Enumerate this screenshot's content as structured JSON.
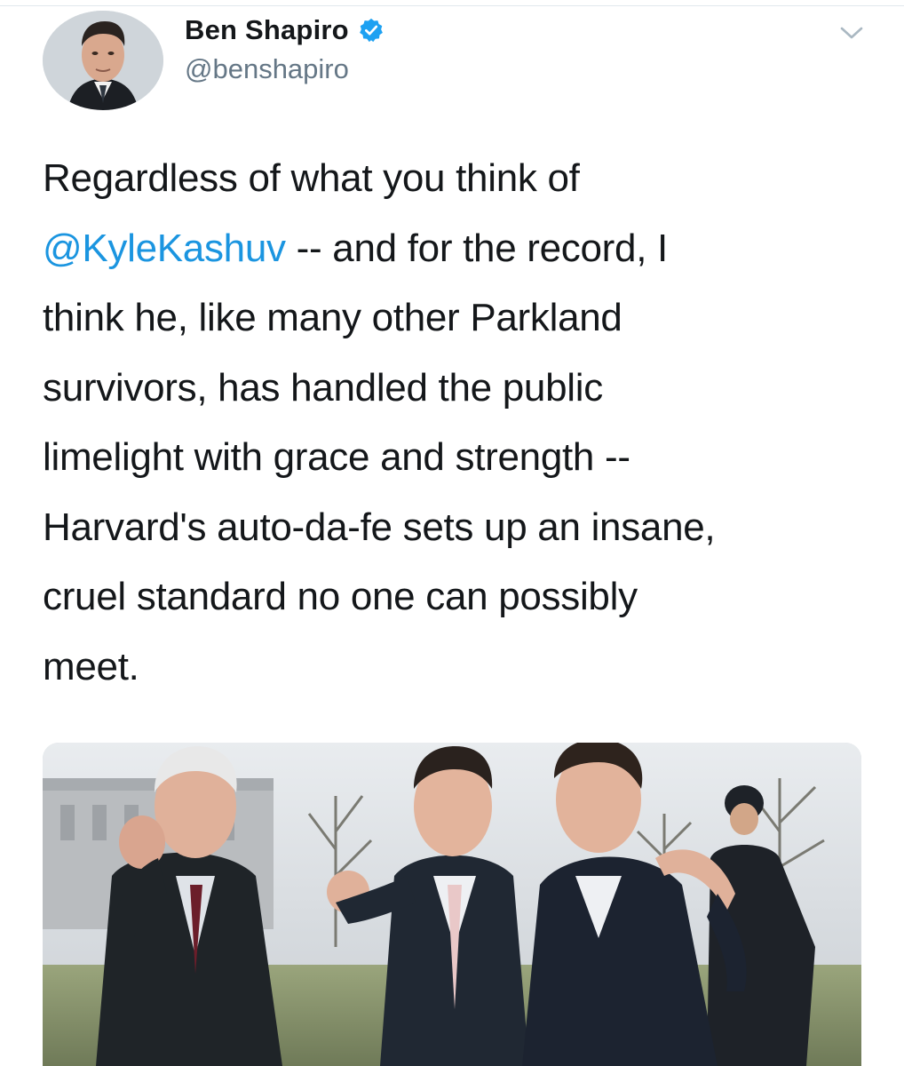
{
  "author": {
    "display_name": "Ben Shapiro",
    "handle": "@benshapiro",
    "verified": true,
    "verified_color": "#1da1f2"
  },
  "tweet": {
    "lines": [
      {
        "prefix": "Regardless of what you think of",
        "mention": "",
        "suffix": ""
      },
      {
        "prefix": "",
        "mention": "@KyleKashuv",
        "suffix": " -- and for the record, I"
      },
      {
        "prefix": "think he, like many other Parkland",
        "mention": "",
        "suffix": ""
      },
      {
        "prefix": "survivors, has handled the public",
        "mention": "",
        "suffix": ""
      },
      {
        "prefix": "limelight with grace and strength --",
        "mention": "",
        "suffix": ""
      },
      {
        "prefix": "Harvard's auto-da-fe sets up an insane,",
        "mention": "",
        "suffix": ""
      },
      {
        "prefix": "cruel standard no one can possibly",
        "mention": "",
        "suffix": ""
      },
      {
        "prefix": "meet.",
        "mention": "",
        "suffix": ""
      }
    ],
    "mention_color": "#1b95e0"
  },
  "icons": {
    "verified": "verified-badge-icon",
    "menu": "chevron-down-icon"
  }
}
